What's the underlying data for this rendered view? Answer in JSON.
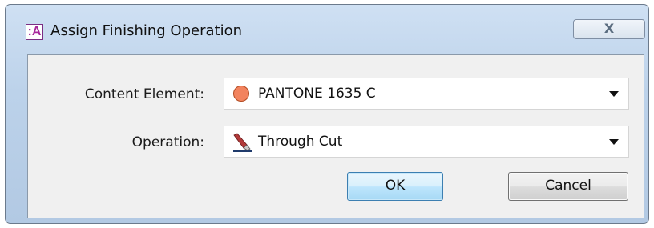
{
  "window": {
    "title": "Assign Finishing Operation",
    "app_icon_text": ":A",
    "close_symbol": "X",
    "app_icon": "app-logo-icon",
    "close_icon": "close-icon"
  },
  "form": {
    "content_element": {
      "label": "Content Element:",
      "value": "PANTONE 1635 C",
      "swatch_color": "#f2835e",
      "icon": "color-swatch-icon"
    },
    "operation": {
      "label": "Operation:",
      "value": "Through Cut",
      "icon": "knife-cut-icon"
    }
  },
  "buttons": {
    "ok_label": "OK",
    "cancel_label": "Cancel"
  },
  "colors": {
    "accent": "#3c7fb1",
    "window_frame": "#bcd2ea",
    "swatch": "#f2835e"
  }
}
